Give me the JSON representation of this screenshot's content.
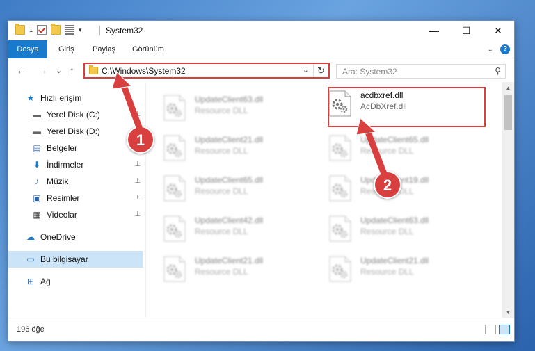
{
  "window": {
    "title": "System32",
    "controls": {
      "minimize": "—",
      "maximize": "☐",
      "close": "✕"
    }
  },
  "qat": {
    "pin_label": "1"
  },
  "ribbon": {
    "tabs": [
      {
        "label": "Dosya"
      },
      {
        "label": "Giriş"
      },
      {
        "label": "Paylaş"
      },
      {
        "label": "Görünüm"
      }
    ],
    "help": "?"
  },
  "navigation": {
    "back": "←",
    "forward": "→",
    "recent": "⌄",
    "up": "↑",
    "address": "C:\\Windows\\System32",
    "address_dropdown": "⌄",
    "refresh": "↻",
    "search_placeholder": "Ara: System32",
    "search_icon": "⚲"
  },
  "sidebar": {
    "items": [
      {
        "label": "Hızlı erişim",
        "icon": "star-icon",
        "glyph": "★",
        "pinned": false
      },
      {
        "label": "Yerel Disk (C:)",
        "icon": "drive-icon",
        "glyph": "▬",
        "pinned": true
      },
      {
        "label": "Yerel Disk (D:)",
        "icon": "drive-icon",
        "glyph": "▬",
        "pinned": false
      },
      {
        "label": "Belgeler",
        "icon": "documents-icon",
        "glyph": "▤",
        "pinned": true
      },
      {
        "label": "İndirmeler",
        "icon": "download-icon",
        "glyph": "⬇",
        "pinned": true
      },
      {
        "label": "Müzik",
        "icon": "music-icon",
        "glyph": "♪",
        "pinned": true
      },
      {
        "label": "Resimler",
        "icon": "pictures-icon",
        "glyph": "▣",
        "pinned": true
      },
      {
        "label": "Videolar",
        "icon": "video-icon",
        "glyph": "▦",
        "pinned": true
      },
      {
        "label": "OneDrive",
        "icon": "cloud-icon",
        "glyph": "☁",
        "pinned": false
      },
      {
        "label": "Bu bilgisayar",
        "icon": "computer-icon",
        "glyph": "▭",
        "pinned": false
      },
      {
        "label": "Ağ",
        "icon": "network-icon",
        "glyph": "⊞",
        "pinned": false
      }
    ],
    "pin_glyph": "📌"
  },
  "files": [
    {
      "name": "UpdateClient63.dll",
      "type": "Resource DLL"
    },
    {
      "name": "UpdateClient21.dll",
      "type": "Resource DLL"
    },
    {
      "name": "UpdateClient65.dll",
      "type": "Resource DLL"
    },
    {
      "name": "UpdateClient42.dll",
      "type": "Resource DLL"
    },
    {
      "name": "UpdateClient21.dll",
      "type": "Resource DLL"
    },
    {
      "name": "acdbxref.dll",
      "type": "AcDbXref.dll"
    },
    {
      "name": "UpdateClient65.dll",
      "type": "Resource DLL"
    },
    {
      "name": "UpdateClient19.dll",
      "type": "Resource DLL"
    },
    {
      "name": "UpdateClient63.dll",
      "type": "Resource DLL"
    },
    {
      "name": "UpdateClient21.dll",
      "type": "Resource DLL"
    }
  ],
  "status": {
    "count": "196 öğe"
  },
  "annotations": {
    "step1": "1",
    "step2": "2",
    "color": "#d84040"
  },
  "colors": {
    "accent": "#1979ca",
    "highlight": "#d84040",
    "selected": "#cce4f7"
  }
}
